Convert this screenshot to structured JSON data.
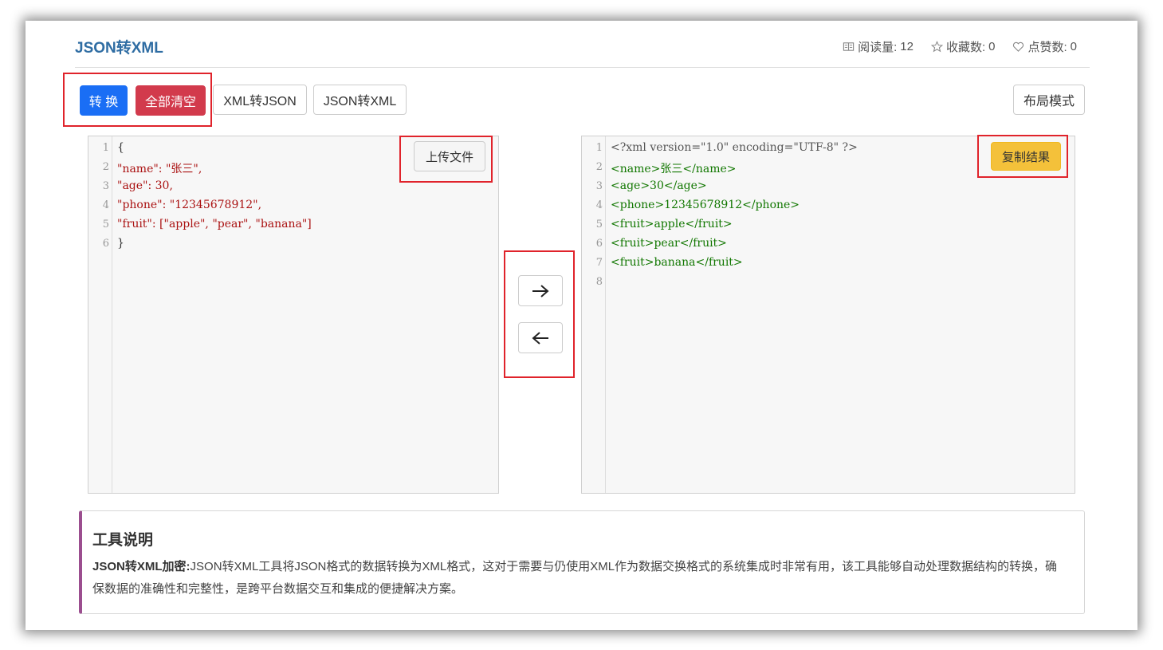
{
  "page": {
    "title": "JSON转XML",
    "stats": [
      {
        "icon": "book-icon",
        "label": "阅读量:",
        "value": "12"
      },
      {
        "icon": "star-icon",
        "label": "收藏数:",
        "value": "0"
      },
      {
        "icon": "heart-icon",
        "label": "点赞数:",
        "value": "0"
      }
    ]
  },
  "toolbar": {
    "convert_label": "转 换",
    "clear_label": "全部清空",
    "xml_to_json_label": "XML转JSON",
    "json_to_xml_label": "JSON转XML",
    "layout_label": "布局模式"
  },
  "left_editor": {
    "upload_label": "上传文件",
    "line_numbers": [
      "1",
      "2",
      "3",
      "4",
      "5",
      "6"
    ],
    "lines": [
      "{",
      "\"name\": \"张三\",",
      "\"age\": 30,",
      "\"phone\": \"12345678912\",",
      "\"fruit\": [\"apple\", \"pear\", \"banana\"]",
      "}"
    ]
  },
  "right_editor": {
    "copy_label": "复制结果",
    "line_numbers": [
      "1",
      "2",
      "3",
      "4",
      "5",
      "6",
      "7",
      "8"
    ],
    "lines": [
      "<?xml version=\"1.0\" encoding=\"UTF-8\" ?>",
      "<name>张三</name>",
      "<age>30</age>",
      "<phone>12345678912</phone>",
      "<fruit>apple</fruit>",
      "<fruit>pear</fruit>",
      "<fruit>banana</fruit>",
      ""
    ]
  },
  "arrows": {
    "right_icon": "arrow-right-icon",
    "left_icon": "arrow-left-icon"
  },
  "description": {
    "title": "工具说明",
    "lead": "JSON转XML加密:",
    "body": "JSON转XML工具将JSON格式的数据转换为XML格式，这对于需要与仍使用XML作为数据交换格式的系统集成时非常有用，该工具能够自动处理数据结构的转换，确保数据的准确性和完整性，是跨平台数据交互和集成的便捷解决方案。"
  },
  "colors": {
    "primary": "#1a6ef5",
    "danger": "#d23a4c",
    "warning": "#f4c13a",
    "title": "#2f6da3",
    "highlight_box": "#e0232b",
    "desc_accent": "#9b4e8f"
  }
}
